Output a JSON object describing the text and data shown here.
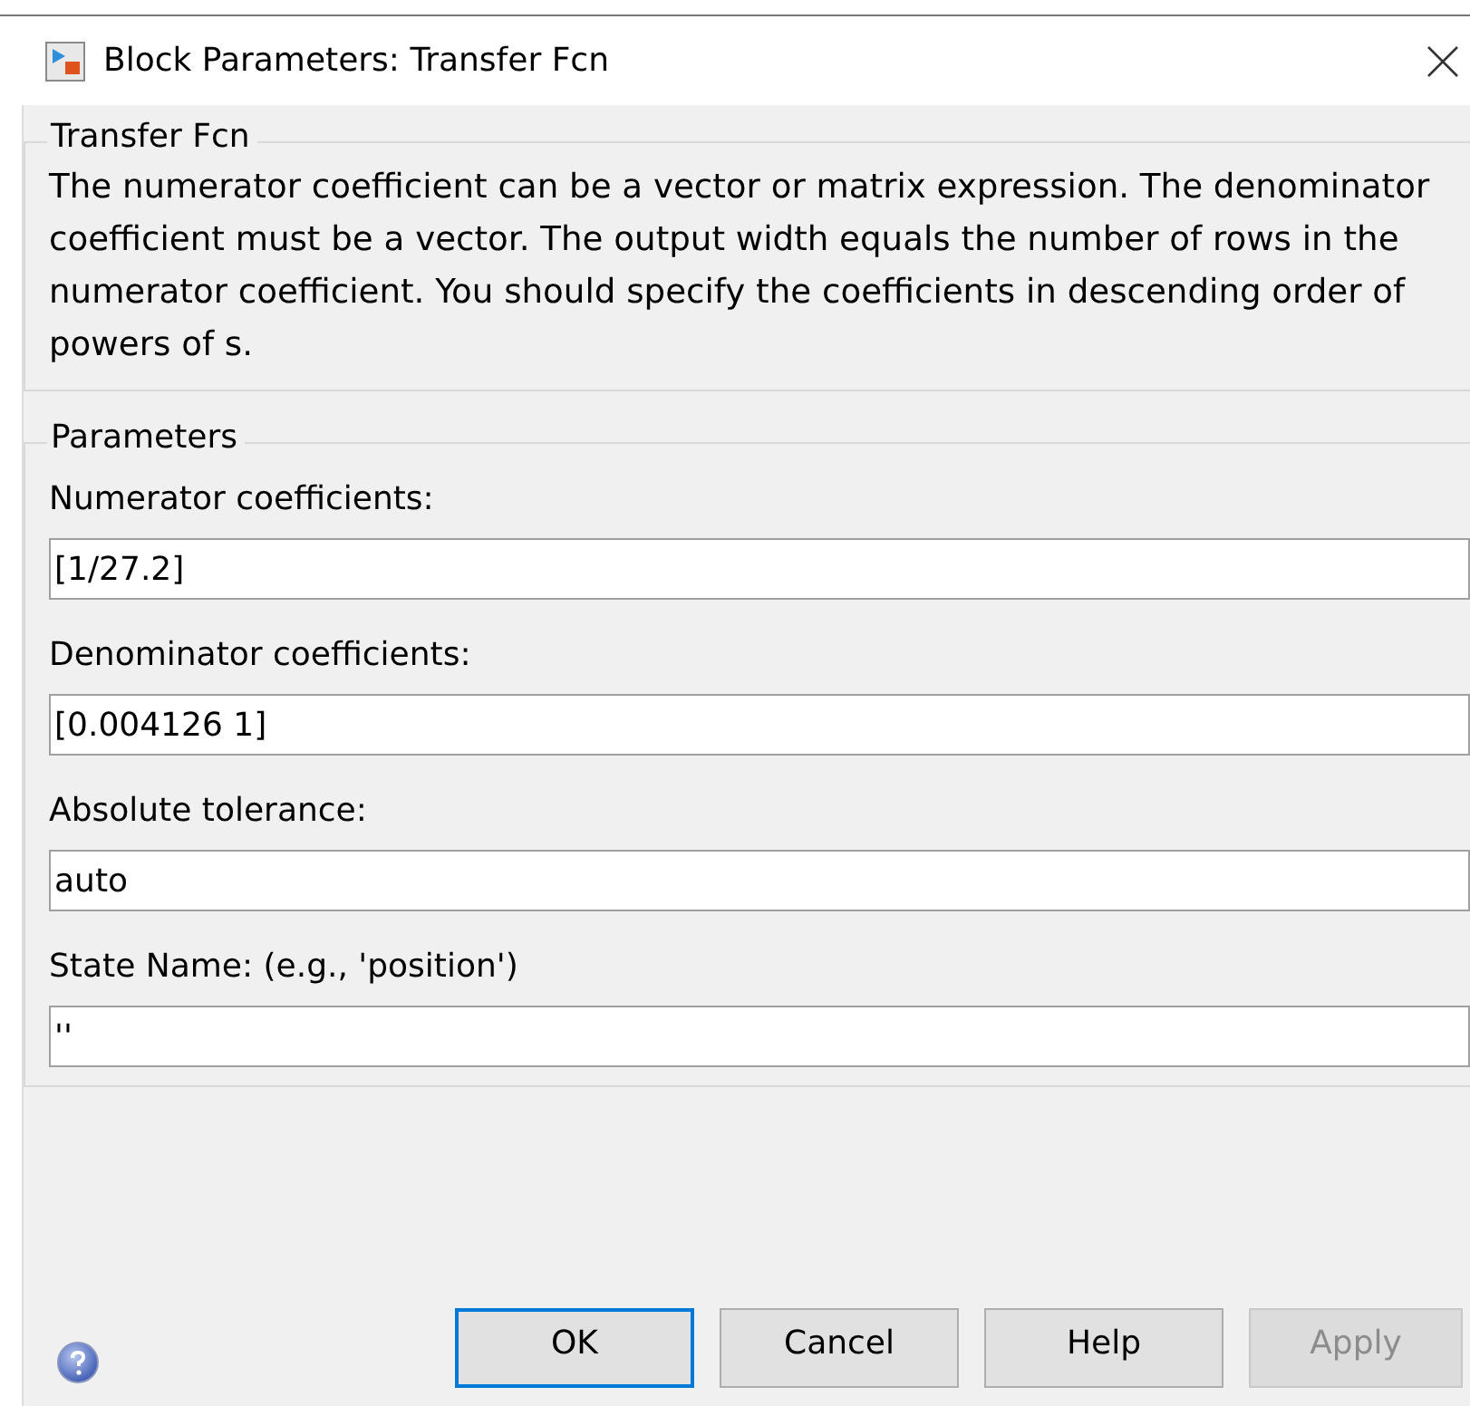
{
  "window": {
    "title": "Block Parameters: Transfer Fcn"
  },
  "description": {
    "title": "Transfer Fcn",
    "text": "The numerator coefficient can be a vector or matrix expression. The denominator coefficient must be a vector. The output width equals the number of rows in the numerator coefficient. You should specify the coefficients in descending order of powers of s."
  },
  "parameters": {
    "title": "Parameters",
    "fields": [
      {
        "label": "Numerator coefficients:",
        "value": "[1/27.2]"
      },
      {
        "label": "Denominator coefficients:",
        "value": "[0.004126 1]"
      },
      {
        "label": "Absolute tolerance:",
        "value": "auto"
      },
      {
        "label": "State Name: (e.g., 'position')",
        "value": "''"
      }
    ]
  },
  "buttons": [
    {
      "label": "OK",
      "default": true,
      "disabled": false
    },
    {
      "label": "Cancel",
      "default": false,
      "disabled": false
    },
    {
      "label": "Help",
      "default": false,
      "disabled": false
    },
    {
      "label": "Apply",
      "default": false,
      "disabled": true
    }
  ]
}
